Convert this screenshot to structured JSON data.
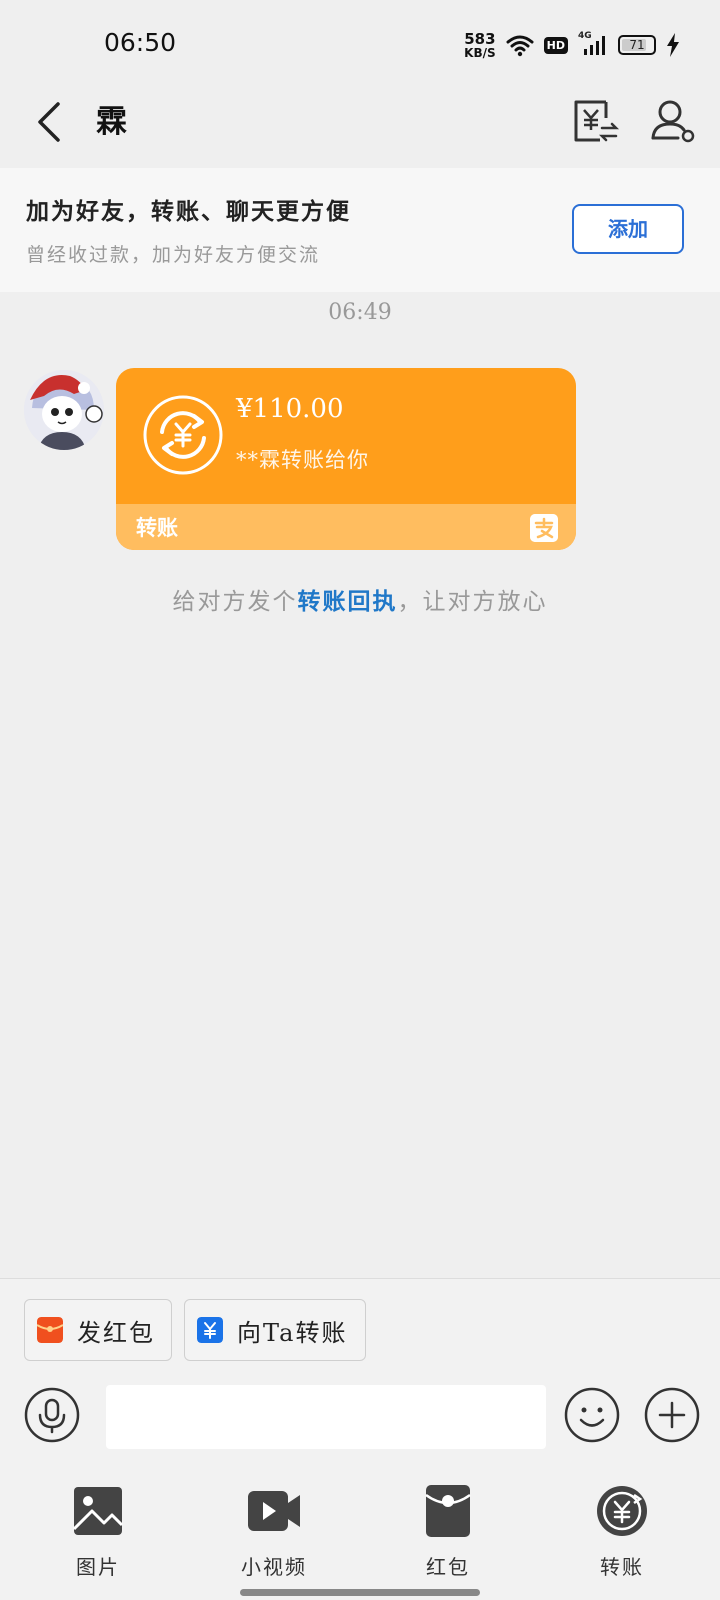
{
  "status_bar": {
    "time": "06:50",
    "net_speed_value": "583",
    "net_speed_unit": "KB/S",
    "hd_label": "HD",
    "network_label": "4G",
    "battery_level": "71"
  },
  "nav": {
    "title": "霖"
  },
  "friend_banner": {
    "title": "加为好友，转账、聊天更方便",
    "subtitle": "曾经收过款，加为好友方便交流",
    "add_button": "添加"
  },
  "chat": {
    "timestamp": "06:49",
    "transfer_card": {
      "amount": "¥110.00",
      "description": "**霖转账给你",
      "footer_label": "转账",
      "accent_color": "#ff9e1b",
      "footer_color": "#ffbd5f"
    },
    "receipt_hint": {
      "before": "给对方发个",
      "link": "转账回执",
      "after": "，让对方放心"
    }
  },
  "bottom": {
    "quick_actions": [
      {
        "label": "发红包",
        "icon": "red-packet-icon",
        "color": "#f0501e"
      },
      {
        "label": "向Ta转账",
        "icon": "transfer-yuan-icon",
        "color": "#1a73e8"
      }
    ],
    "input": {
      "value": "",
      "placeholder": ""
    },
    "tools": [
      {
        "label": "图片",
        "icon": "image-icon"
      },
      {
        "label": "小视频",
        "icon": "video-icon"
      },
      {
        "label": "红包",
        "icon": "red-packet-icon"
      },
      {
        "label": "转账",
        "icon": "transfer-icon"
      }
    ]
  }
}
